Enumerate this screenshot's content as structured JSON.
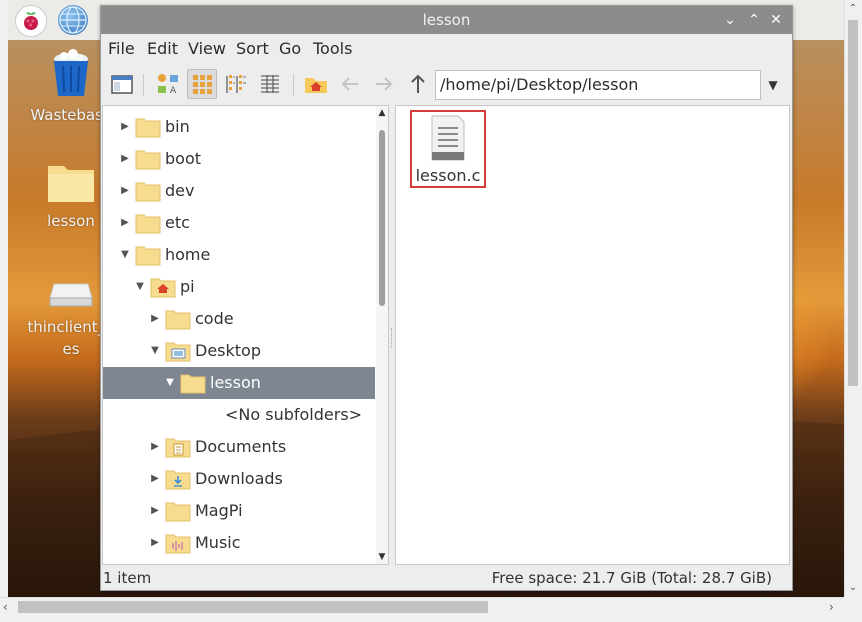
{
  "desktop": {
    "icons": [
      {
        "label": "Wastebask",
        "icon": "trash-icon"
      },
      {
        "label": "lesson",
        "icon": "folder-icon"
      },
      {
        "label": "thinclient_d",
        "label2": "es",
        "icon": "drive-icon"
      }
    ],
    "dock": [
      {
        "icon": "raspberry-menu-icon"
      },
      {
        "icon": "web-browser-icon"
      }
    ]
  },
  "window": {
    "title": "lesson",
    "controls": {
      "minimize": "⌄",
      "maximize": "⌃",
      "close": "✕"
    }
  },
  "menubar": {
    "items": [
      "File",
      "Edit",
      "View",
      "Sort",
      "Go",
      "Tools"
    ]
  },
  "toolbar": {
    "path": "/home/pi/Desktop/lesson",
    "buttons": [
      {
        "icon": "new-window-icon"
      },
      {
        "icon": "icon-view-icon"
      },
      {
        "icon": "thumbnail-view-icon",
        "active": true
      },
      {
        "icon": "compact-view-icon"
      },
      {
        "icon": "list-view-icon"
      },
      {
        "icon": "home-icon"
      },
      {
        "icon": "back-arrow-icon"
      },
      {
        "icon": "forward-arrow-icon"
      },
      {
        "icon": "up-arrow-icon"
      }
    ]
  },
  "tree": {
    "rows": [
      {
        "label": "bin",
        "expander": "▶",
        "folder": "plain"
      },
      {
        "label": "boot",
        "expander": "▶",
        "folder": "plain"
      },
      {
        "label": "dev",
        "expander": "▶",
        "folder": "plain"
      },
      {
        "label": "etc",
        "expander": "▶",
        "folder": "plain"
      },
      {
        "label": "home",
        "expander": "▼",
        "folder": "plain"
      },
      {
        "label": "pi",
        "expander": "▼",
        "folder": "home"
      },
      {
        "label": "code",
        "expander": "▶",
        "folder": "plain"
      },
      {
        "label": "Desktop",
        "expander": "▼",
        "folder": "desktop"
      },
      {
        "label": "lesson",
        "expander": "▼",
        "folder": "plain",
        "selected": true
      },
      {
        "label": "<No subfolders>",
        "expander": "",
        "folder": "none"
      },
      {
        "label": "Documents",
        "expander": "▶",
        "folder": "documents"
      },
      {
        "label": "Downloads",
        "expander": "▶",
        "folder": "downloads"
      },
      {
        "label": "MagPi",
        "expander": "▶",
        "folder": "plain"
      },
      {
        "label": "Music",
        "expander": "▶",
        "folder": "music"
      }
    ]
  },
  "content": {
    "files": [
      {
        "name": "lesson.c",
        "icon": "text-file-icon",
        "highlighted": true
      }
    ]
  },
  "statusbar": {
    "count": "1 item",
    "free_space": "Free space: 21.7 GiB (Total: 28.7 GiB)"
  },
  "colors": {
    "titlebar": "#8c8c8c",
    "selection": "#7e8791",
    "folder": "#f7dc8f",
    "highlight_border": "#d43a3a"
  }
}
